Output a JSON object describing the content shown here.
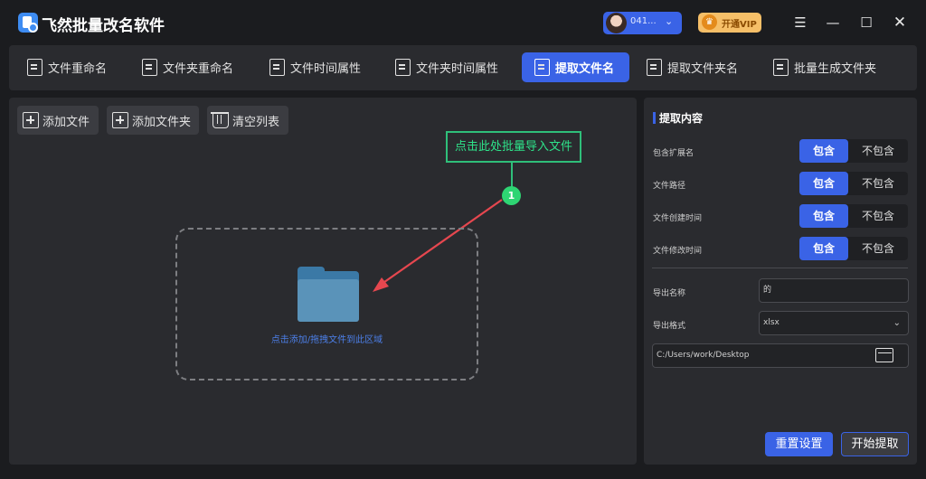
{
  "app": {
    "title": "飞然批量改名软件"
  },
  "user": {
    "name": "041...",
    "vip_label": "开通VIP",
    "vip_icon": "crown-icon"
  },
  "window_controls": [
    "menu-icon",
    "minimize-icon",
    "maximize-icon",
    "close-icon"
  ],
  "tabs": [
    {
      "label": "文件重命名",
      "icon": "file-rename-icon"
    },
    {
      "label": "文件夹重命名",
      "icon": "terminal-icon"
    },
    {
      "label": "文件时间属性",
      "icon": "file-clock-icon"
    },
    {
      "label": "文件夹时间属性",
      "icon": "folder-clock-icon"
    },
    {
      "label": "提取文件名",
      "icon": "extract-file-icon",
      "active": true
    },
    {
      "label": "提取文件夹名",
      "icon": "extract-folder-icon"
    },
    {
      "label": "批量生成文件夹",
      "icon": "gear-folder-icon"
    }
  ],
  "toolbar": {
    "add_file": "添加文件",
    "add_folder": "添加文件夹",
    "clear_list": "清空列表"
  },
  "guide": {
    "tip": "点击此处批量导入文件",
    "step": "1"
  },
  "drop_zone": {
    "label": "点击添加/拖拽文件到此区域"
  },
  "extract": {
    "title": "提取内容",
    "options": [
      {
        "label": "包含扩展名",
        "on": "包含",
        "off": "不包含"
      },
      {
        "label": "文件路径",
        "on": "包含",
        "off": "不包含"
      },
      {
        "label": "文件创建时间",
        "on": "包含",
        "off": "不包含"
      },
      {
        "label": "文件修改时间",
        "on": "包含",
        "off": "不包含"
      }
    ],
    "export_name_label": "导出名称",
    "export_name_value": "的",
    "export_format_label": "导出格式",
    "export_format_value": "xlsx",
    "export_path": "C:/Users/work/Desktop",
    "reset_label": "重置设置",
    "start_label": "开始提取"
  },
  "colors": {
    "accent": "#3a63e6",
    "guide": "#2ed573",
    "arrow": "#e6474f",
    "vip": "#f6bf68"
  }
}
